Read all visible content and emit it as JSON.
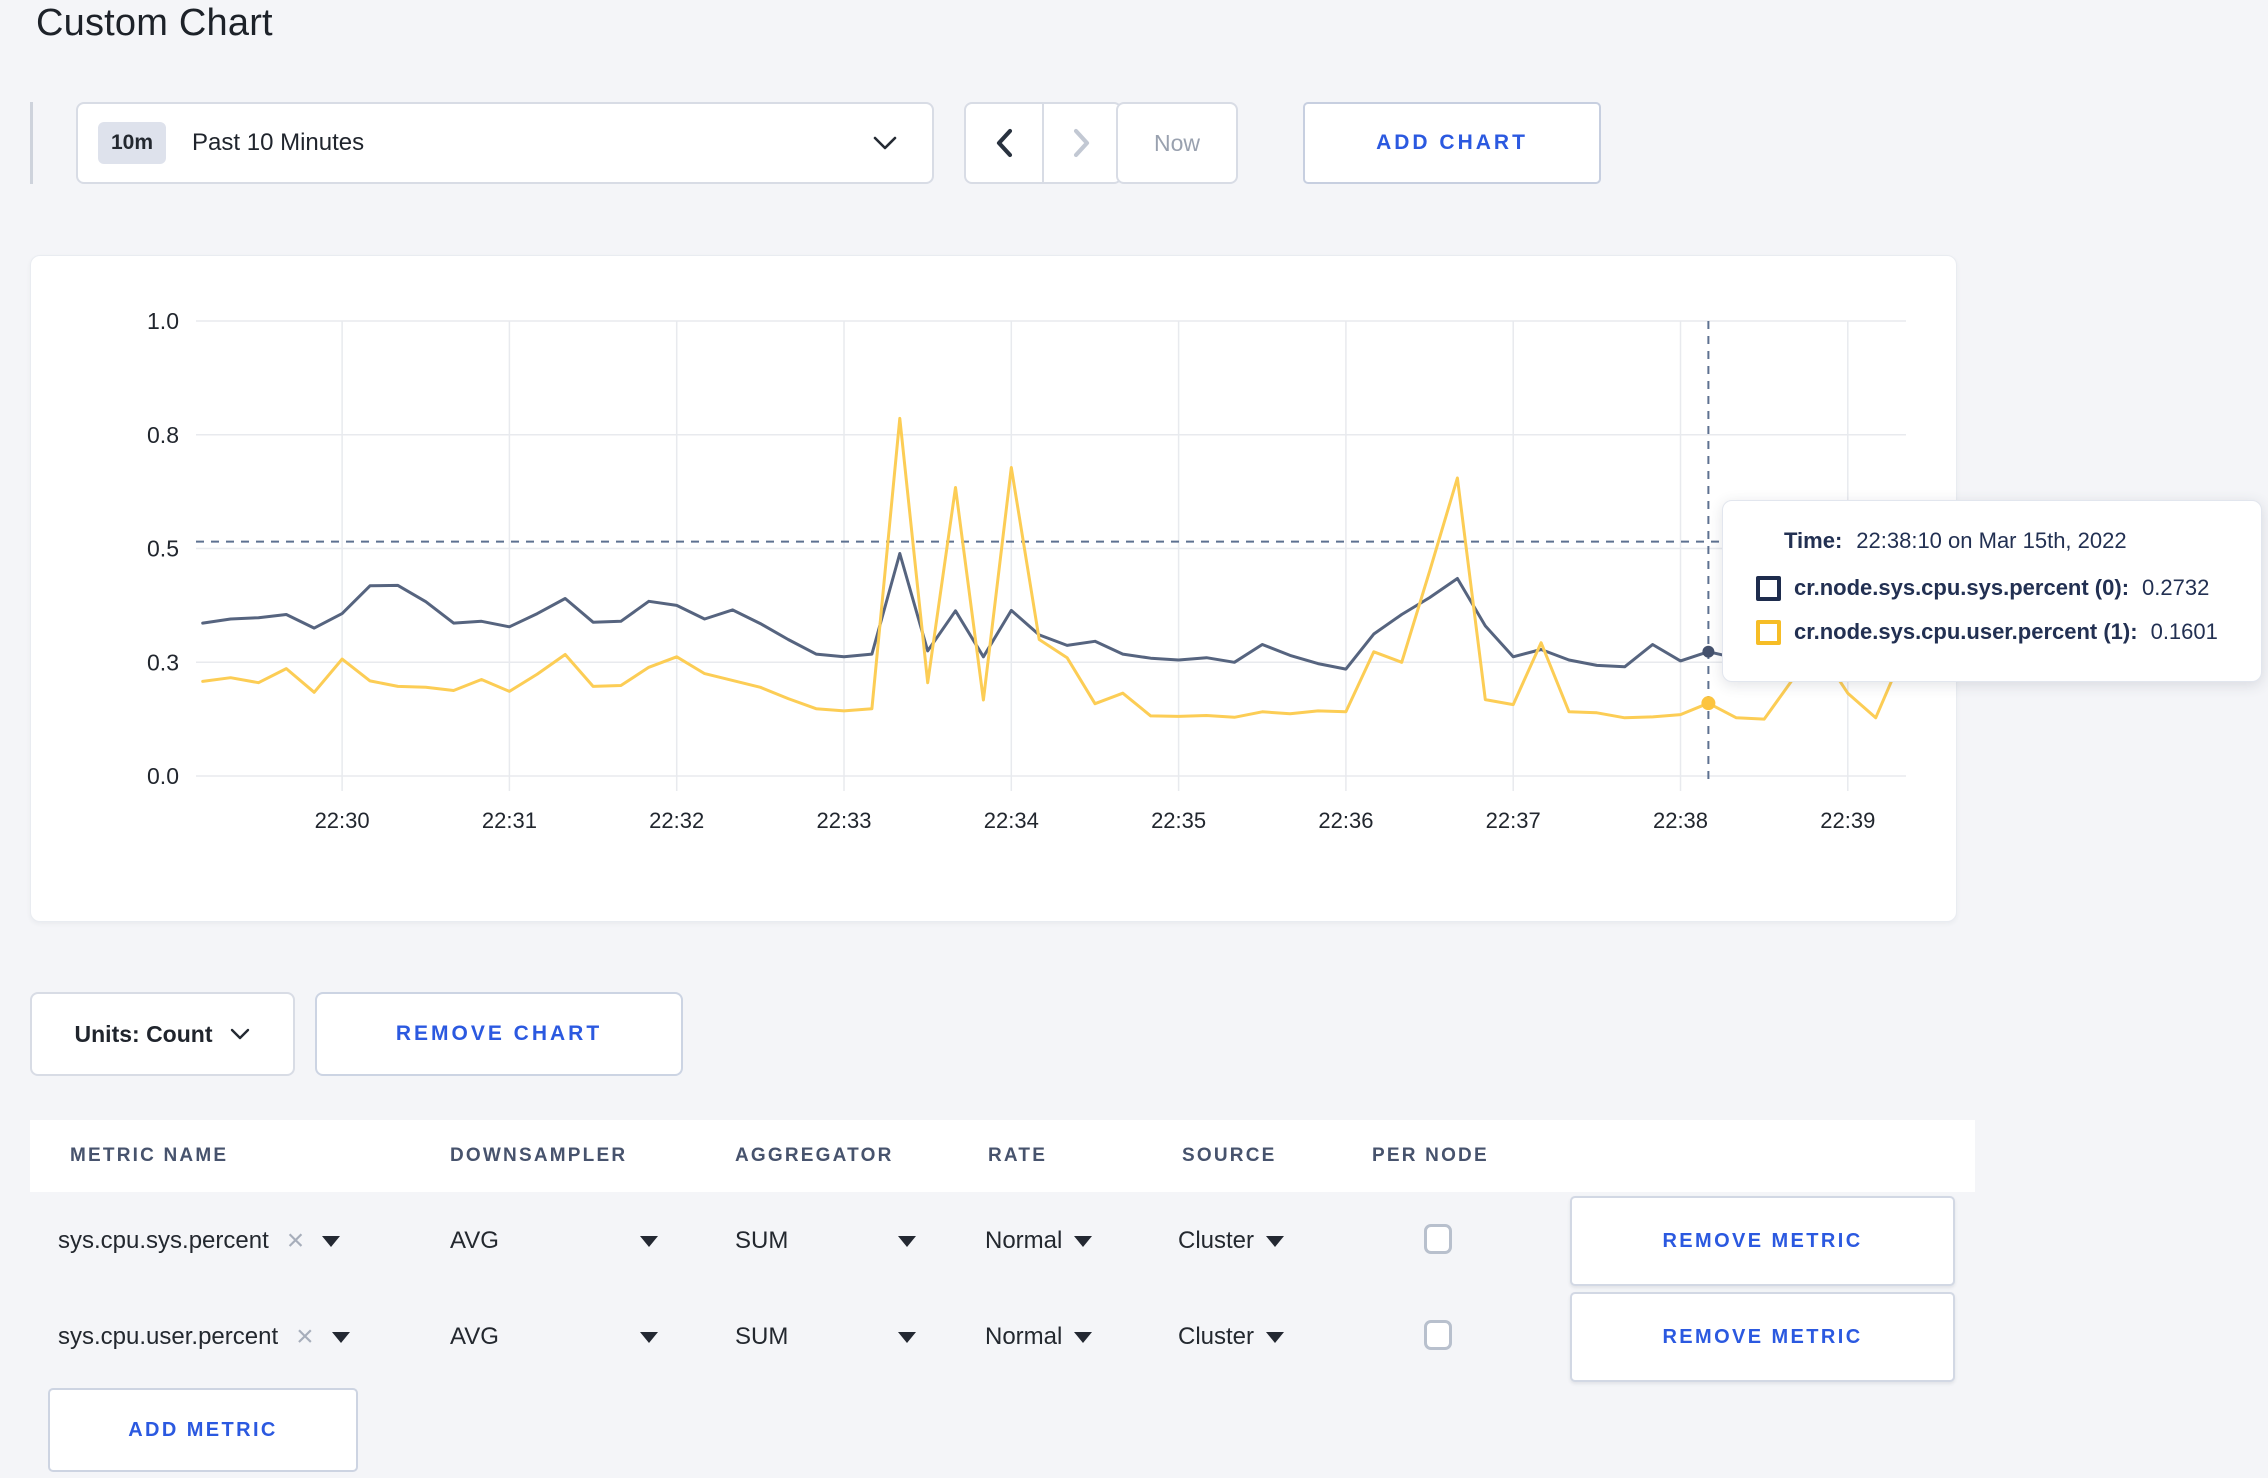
{
  "page": {
    "title": "Custom Chart"
  },
  "colors": {
    "accent": "#2b59e0",
    "series_sys": "#56647f",
    "series_user": "#fccd55"
  },
  "toolbar": {
    "time_badge": "10m",
    "time_label": "Past 10 Minutes",
    "now_label": "Now",
    "add_chart_label": "ADD CHART"
  },
  "tooltip": {
    "time_label": "Time:",
    "time_value": "22:38:10 on Mar 15th, 2022",
    "series": [
      {
        "name": "cr.node.sys.cpu.sys.percent (0):",
        "value": "0.2732",
        "swatch": "#1e2c4d"
      },
      {
        "name": "cr.node.sys.cpu.user.percent (1):",
        "value": "0.1601",
        "swatch": "#f6bd26"
      }
    ]
  },
  "chart_footer": {
    "units_label": "Units: Count",
    "remove_chart_label": "REMOVE CHART"
  },
  "metrics_table": {
    "headers": [
      "METRIC NAME",
      "DOWNSAMPLER",
      "AGGREGATOR",
      "RATE",
      "SOURCE",
      "PER NODE"
    ],
    "rows": [
      {
        "metric": "sys.cpu.sys.percent",
        "downsampler": "AVG",
        "aggregator": "SUM",
        "rate": "Normal",
        "source": "Cluster",
        "per_node": false,
        "remove_label": "REMOVE METRIC"
      },
      {
        "metric": "sys.cpu.user.percent",
        "downsampler": "AVG",
        "aggregator": "SUM",
        "rate": "Normal",
        "source": "Cluster",
        "per_node": false,
        "remove_label": "REMOVE METRIC"
      }
    ],
    "add_metric_label": "ADD METRIC"
  },
  "chart_data": {
    "type": "line",
    "title": "",
    "x_start": "22:29:10",
    "x_interval_seconds": 10,
    "grid": true,
    "ylim": [
      0,
      1
    ],
    "x_ticks": [
      {
        "label": "22:30",
        "t": 50
      },
      {
        "label": "22:31",
        "t": 110
      },
      {
        "label": "22:32",
        "t": 170
      },
      {
        "label": "22:33",
        "t": 230
      },
      {
        "label": "22:34",
        "t": 290
      },
      {
        "label": "22:35",
        "t": 350
      },
      {
        "label": "22:36",
        "t": 410
      },
      {
        "label": "22:37",
        "t": 470
      },
      {
        "label": "22:38",
        "t": 530
      },
      {
        "label": "22:39",
        "t": 590
      }
    ],
    "y_ticks": [
      {
        "label": "0.0",
        "v": 0
      },
      {
        "label": "0.3",
        "v": 0.25
      },
      {
        "label": "0.5",
        "v": 0.5
      },
      {
        "label": "0.8",
        "v": 0.75
      },
      {
        "label": "1.0",
        "v": 1
      }
    ],
    "series": [
      {
        "name": "cr.node.sys.cpu.sys.percent",
        "color": "#56647f",
        "dot_color": "#44516d",
        "values": [
          0.336,
          0.345,
          0.348,
          0.355,
          0.325,
          0.357,
          0.418,
          0.419,
          0.383,
          0.336,
          0.34,
          0.328,
          0.357,
          0.39,
          0.338,
          0.34,
          0.384,
          0.375,
          0.345,
          0.365,
          0.335,
          0.3,
          0.268,
          0.262,
          0.268,
          0.489,
          0.275,
          0.363,
          0.262,
          0.364,
          0.31,
          0.287,
          0.296,
          0.268,
          0.259,
          0.255,
          0.26,
          0.25,
          0.289,
          0.265,
          0.247,
          0.235,
          0.312,
          0.355,
          0.392,
          0.434,
          0.33,
          0.262,
          0.278,
          0.255,
          0.243,
          0.24,
          0.289,
          0.253,
          0.2732,
          0.259,
          0.27,
          0.29,
          0.3,
          0.295,
          0.3,
          0.305
        ]
      },
      {
        "name": "cr.node.sys.cpu.user.percent",
        "color": "#fccd55",
        "dot_color": "#fcc43f",
        "values": [
          0.208,
          0.216,
          0.205,
          0.236,
          0.184,
          0.257,
          0.209,
          0.197,
          0.195,
          0.188,
          0.212,
          0.186,
          0.224,
          0.267,
          0.197,
          0.199,
          0.239,
          0.262,
          0.225,
          0.21,
          0.195,
          0.17,
          0.148,
          0.143,
          0.148,
          0.786,
          0.205,
          0.634,
          0.167,
          0.678,
          0.3,
          0.26,
          0.159,
          0.182,
          0.132,
          0.131,
          0.133,
          0.129,
          0.141,
          0.137,
          0.143,
          0.141,
          0.273,
          0.25,
          0.45,
          0.655,
          0.168,
          0.157,
          0.293,
          0.141,
          0.139,
          0.128,
          0.13,
          0.135,
          0.1601,
          0.128,
          0.125,
          0.21,
          0.275,
          0.182,
          0.128,
          0.27
        ]
      }
    ],
    "crosshair": {
      "t": 540,
      "time": "22:38:10",
      "hover_value": 0.515,
      "point_values": [
        0.2732,
        0.1601
      ]
    }
  }
}
